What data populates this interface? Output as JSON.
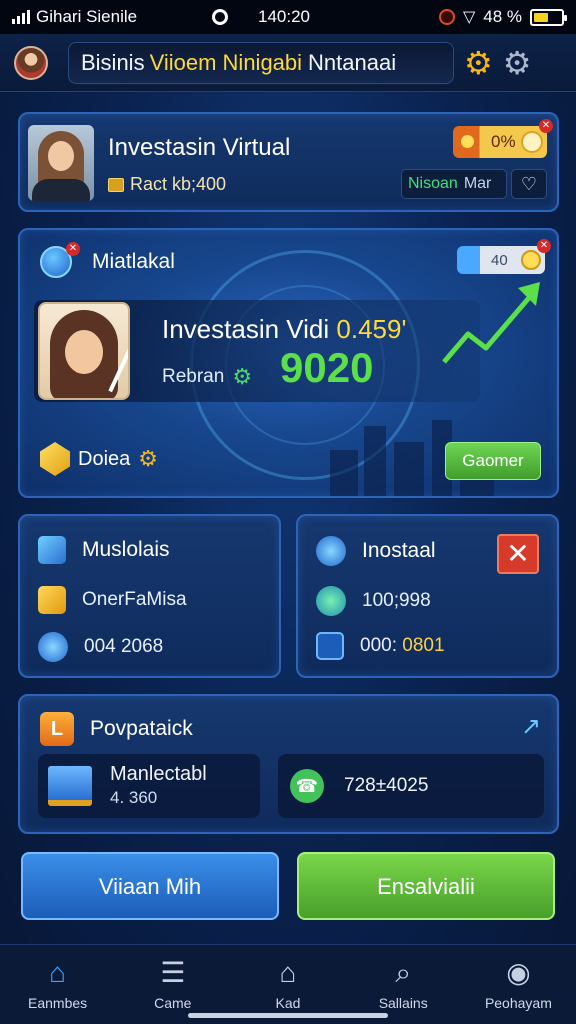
{
  "status_bar": {
    "carrier": "Gihari Sienile",
    "time": "140:20",
    "battery_text": "48 %"
  },
  "header": {
    "title_part1": "Bisinis",
    "title_accent": "Viioem Ninigabi",
    "title_part2": "Nntanaai"
  },
  "profile": {
    "name": "Investasin Virtual",
    "sub": "Ract kb;400",
    "percent": "0%",
    "status_green": "Nisoan",
    "status_grey": "Mar"
  },
  "investment_card": {
    "title": "Miatlakal",
    "toggle_value": "40",
    "invest_title": "Investasin Vidi",
    "invest_highlight": "0.459'",
    "label": "Rebran",
    "value": "9020",
    "coins_label": "Doiea",
    "action_button": "Gaomer"
  },
  "card_left": {
    "title": "Muslolais",
    "row1": "OnerFaMisa",
    "row2": "004 2068"
  },
  "card_right": {
    "title": "Inostaal",
    "row1": "100;998",
    "row2_prefix": "000:",
    "row2_value": "0801"
  },
  "wide_card": {
    "title": "Povpataick",
    "item1_line1": "Manlectabl",
    "item1_line2": "4. 360",
    "item2": "728±4025"
  },
  "buttons": {
    "primary": "Viiaan Mih",
    "secondary": "Ensalvialii"
  },
  "bottom_nav": [
    {
      "label": "Eanmbes",
      "icon": "home-icon",
      "active": true
    },
    {
      "label": "Came",
      "icon": "list-icon",
      "active": false
    },
    {
      "label": "Kad",
      "icon": "house-outline-icon",
      "active": false
    },
    {
      "label": "Sallains",
      "icon": "search-icon",
      "active": false
    },
    {
      "label": "Peohayam",
      "icon": "location-pin-icon",
      "active": false
    }
  ],
  "colors": {
    "background": "#0a2352",
    "accent_gold": "#ffd83a",
    "value_green": "#5be04a",
    "panel_border": "#2b64b8"
  }
}
